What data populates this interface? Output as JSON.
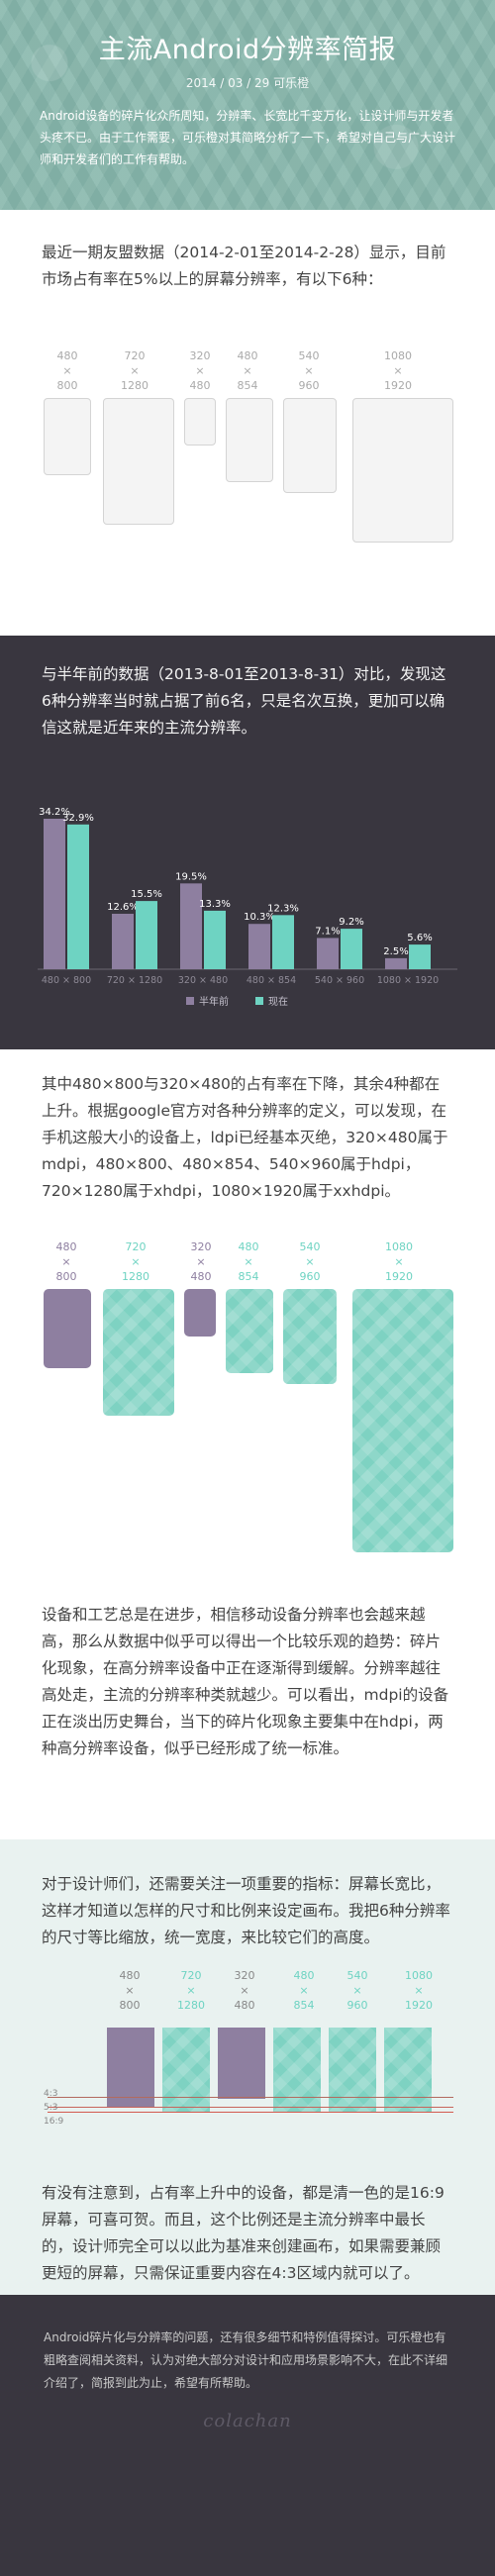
{
  "header": {
    "title": "主流Android分辨率简报",
    "meta": "2014 / 03 / 29   可乐橙",
    "intro": "Android设备的碎片化众所周知，分辨率、长宽比千变万化，让设计师与开发者头疼不已。由于工作需要，可乐橙对其简略分析了一下，希望对自己与广大设计师和开发者们的工作有帮助。"
  },
  "current": {
    "text": "最近一期友盟数据（2014-2-01至2014-2-28）显示，目前市场占有率在5%以上的屏幕分辨率，有以下6种：",
    "resolutions": [
      {
        "w": "480",
        "x": "×",
        "h": "800"
      },
      {
        "w": "720",
        "x": "×",
        "h": "1280"
      },
      {
        "w": "320",
        "x": "×",
        "h": "480"
      },
      {
        "w": "480",
        "x": "×",
        "h": "854"
      },
      {
        "w": "540",
        "x": "×",
        "h": "960"
      },
      {
        "w": "1080",
        "x": "×",
        "h": "1920"
      }
    ]
  },
  "compare": {
    "text": "与半年前的数据（2013-8-01至2013-8-31）对比，发现这6种分辨率当时就占据了前6名，只是名次互换，更加可以确信这就是近年来的主流分辨率。",
    "colors": {
      "before": "#8e7fa0",
      "now": "#6ed3c2",
      "axis": "#6a6672"
    }
  },
  "chart_data": {
    "type": "bar",
    "categories": [
      "480 × 800",
      "720 × 1280",
      "320 × 480",
      "480 × 854",
      "540 × 960",
      "1080 × 1920"
    ],
    "series": [
      {
        "name": "半年前",
        "values": [
          34.2,
          12.6,
          19.5,
          10.3,
          7.1,
          2.5
        ],
        "labels": [
          "34.2%",
          "12.6%",
          "19.5%",
          "10.3%",
          "7.1%",
          "2.5%"
        ]
      },
      {
        "name": "现在",
        "values": [
          32.9,
          15.5,
          13.3,
          12.3,
          9.2,
          5.6
        ],
        "labels": [
          "32.9%",
          "15.5%",
          "13.3%",
          "12.3%",
          "9.2%",
          "5.6%"
        ]
      }
    ],
    "ylim": [
      0,
      36
    ],
    "legend": "bottom-center"
  },
  "trend": {
    "text": "其中480×800与320×480的占有率在下降，其余4种都在上升。根据google官方对各种分辨率的定义，可以发现，在手机这般大小的设备上，ldpi已经基本灭绝，320×480属于mdpi，480×800、480×854、540×960属于hdpi，720×1280属于xhdpi，1080×1920属于xxhdpi。",
    "items": [
      {
        "w": "480",
        "x": "×",
        "h": "800",
        "trend": "down"
      },
      {
        "w": "720",
        "x": "×",
        "h": "1280",
        "trend": "up"
      },
      {
        "w": "320",
        "x": "×",
        "h": "480",
        "trend": "down"
      },
      {
        "w": "480",
        "x": "×",
        "h": "854",
        "trend": "up"
      },
      {
        "w": "540",
        "x": "×",
        "h": "960",
        "trend": "up"
      },
      {
        "w": "1080",
        "x": "×",
        "h": "1920",
        "trend": "up"
      }
    ]
  },
  "progress": {
    "text": "设备和工艺总是在进步，相信移动设备分辨率也会越来越高，那么从数据中似乎可以得出一个比较乐观的趋势：碎片化现象，在高分辨率设备中正在逐渐得到缓解。分辨率越往高处走，主流的分辨率种类就越少。可以看出，mdpi的设备正在淡出历史舞台，当下的碎片化现象主要集中在hdpi，两种高分辨率设备，似乎已经形成了统一标准。"
  },
  "ratio": {
    "text": "对于设计师们，还需要关注一项重要的指标：屏幕长宽比，这样才知道以怎样的尺寸和比例来设定画布。我把6种分辨率的尺寸等比缩放，统一宽度，来比较它们的高度。",
    "ratio_labels": [
      "4:3",
      "5:3",
      "16:9"
    ],
    "text2": "有没有注意到，占有率上升中的设备，都是清一色的是16:9屏幕，可喜可贺。而且，这个比例还是主流分辨率中最长的，设计师完全可以以此为基准来创建画布，如果需要兼顾更短的屏幕，只需保证重要内容在4:3区域内就可以了。"
  },
  "footer": {
    "text": "Android碎片化与分辨率的问题，还有很多细节和特例值得探讨。可乐橙也有粗略查阅相关资料，认为对绝大部分对设计和应用场景影响不大，在此不详细介绍了，简报到此为止，希望有所帮助。",
    "signature": "colachan"
  }
}
